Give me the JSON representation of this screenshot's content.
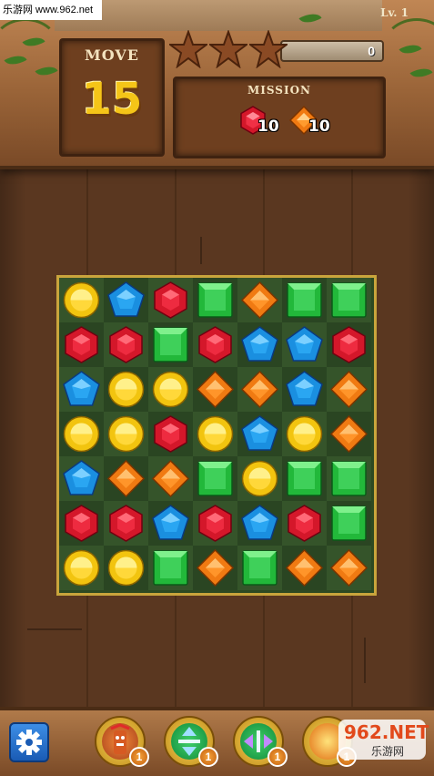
{
  "watermark_top": "乐游网 www.962.net",
  "watermark_bottom": {
    "logo": "962.NET",
    "sub": "乐游网"
  },
  "level": "Lv. 1",
  "move": {
    "label": "MOVE",
    "count": "15"
  },
  "stars": {
    "earned": 0,
    "total": 3
  },
  "score": "0",
  "mission": {
    "label": "MISSION",
    "targets": [
      {
        "gem": "red",
        "count": "10"
      },
      {
        "gem": "orange",
        "count": "10"
      }
    ]
  },
  "board": {
    "cols": 7,
    "rows": 7,
    "grid": [
      [
        "yellow",
        "blue",
        "red",
        "green",
        "orange",
        "green",
        "green"
      ],
      [
        "red",
        "red",
        "green",
        "red",
        "blue",
        "blue",
        "red"
      ],
      [
        "blue",
        "yellow",
        "yellow",
        "orange",
        "orange",
        "blue",
        "orange"
      ],
      [
        "yellow",
        "yellow",
        "red",
        "yellow",
        "blue",
        "yellow",
        "orange"
      ],
      [
        "blue",
        "orange",
        "orange",
        "green",
        "yellow",
        "green",
        "green"
      ],
      [
        "red",
        "red",
        "blue",
        "red",
        "blue",
        "red",
        "green"
      ],
      [
        "yellow",
        "yellow",
        "green",
        "orange",
        "green",
        "orange",
        "orange"
      ]
    ]
  },
  "gem_colors": {
    "red": "#d4172a",
    "blue": "#1a8fe0",
    "green": "#22b83a",
    "yellow": "#f2c40f",
    "orange": "#f07a12"
  },
  "boosters": [
    {
      "icon": "tiki-totem-icon",
      "count": "1"
    },
    {
      "icon": "horizontal-arrows-icon",
      "count": "1"
    },
    {
      "icon": "vertical-arrows-icon",
      "count": "1"
    },
    {
      "icon": "fireball-icon",
      "count": "1"
    }
  ],
  "settings_icon": "gear-icon"
}
